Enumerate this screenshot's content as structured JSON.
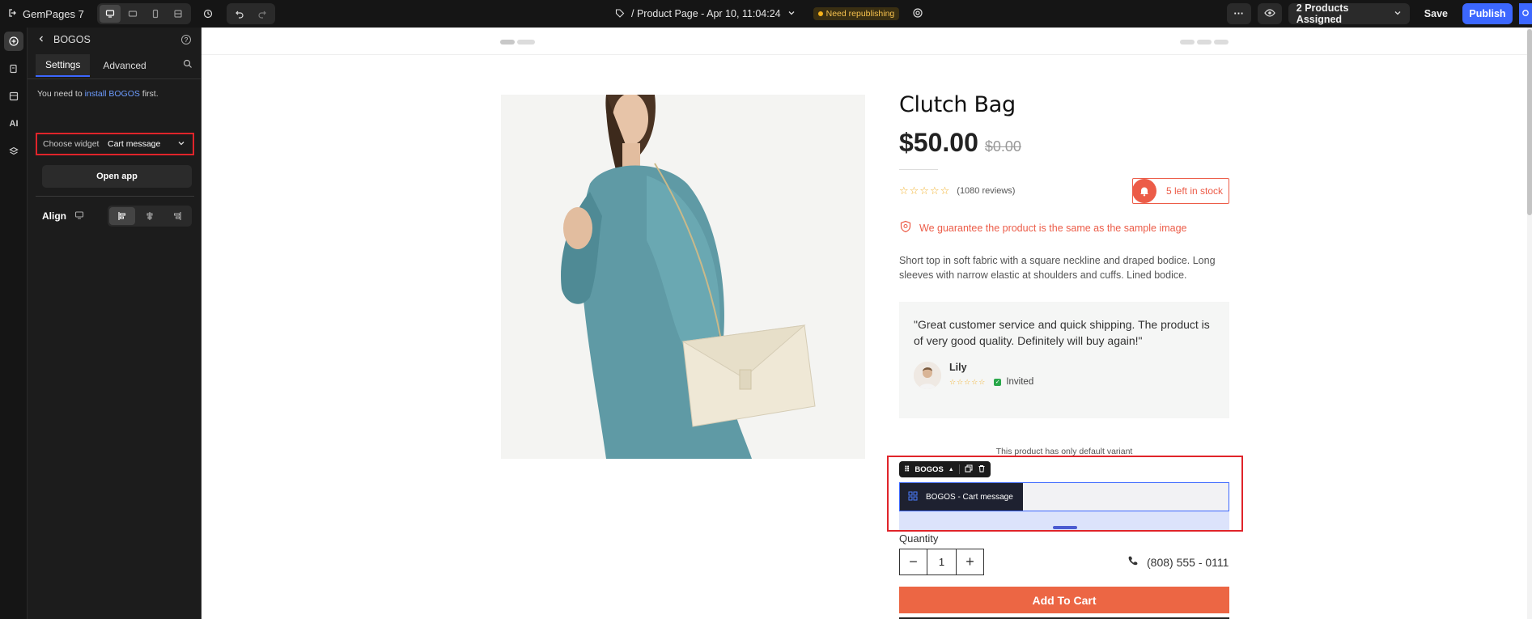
{
  "topbar": {
    "app_name": "GemPages 7",
    "page_title": "/ Product Page - Apr 10, 11:04:24",
    "status_badge": "Need republishing",
    "assigned": "2 Products Assigned",
    "save_label": "Save",
    "publish_label": "Publish"
  },
  "panel": {
    "title": "BOGOS",
    "tabs": [
      "Settings",
      "Advanced"
    ],
    "note_prefix": "You need to ",
    "note_link": "install BOGOS",
    "note_suffix": " first.",
    "choose_widget_label": "Choose widget",
    "choose_widget_value": "Cart message",
    "open_app_label": "Open app",
    "align_label": "Align"
  },
  "product": {
    "title": "Clutch Bag",
    "price": "$50.00",
    "compare_price": "$0.00",
    "rating_stars": "☆☆☆☆☆",
    "reviews": "(1080 reviews)",
    "stock": "5 left in stock",
    "guarantee": "We guarantee the product is the same as the sample image",
    "description": "Short top in soft fabric with a square neckline and draped bodice. Long sleeves with narrow elastic at shoulders and cuffs. Lined bodice.",
    "testimonial": {
      "quote": "\"Great customer service and quick shipping. The product is of very good quality. Definitely will buy again!\"",
      "author": "Lily",
      "stars": "☆☆☆☆☆",
      "badge": "Invited"
    },
    "variant_note": "This product has only default variant",
    "bogos_toolbar_label": "BOGOS",
    "bogos_widget_label": "BOGOS - Cart message",
    "quantity_label": "Quantity",
    "quantity_value": "1",
    "phone": "(808) 555 - 0111",
    "add_to_cart": "Add To Cart"
  },
  "colors": {
    "accent": "#3c67ff",
    "brand_orange": "#ec6644",
    "highlight_red": "#e0242a",
    "badge_yellow": "#f6c14e"
  }
}
